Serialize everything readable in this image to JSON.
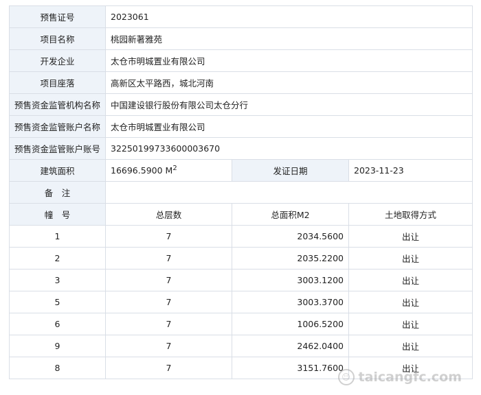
{
  "fields": {
    "permit_no": {
      "label": "预售证号",
      "value": "2023061"
    },
    "project_name": {
      "label": "项目名称",
      "value": "桃园新著雅苑"
    },
    "developer": {
      "label": "开发企业",
      "value": "太仓市明城置业有限公司"
    },
    "location": {
      "label": "项目座落",
      "value": "高新区太平路西，城北河南"
    },
    "supervisor_org": {
      "label": "预售资金监管机构名称",
      "value": "中国建设银行股份有限公司太仓分行"
    },
    "account_name": {
      "label": "预售资金监管账户名称",
      "value": "太仓市明城置业有限公司"
    },
    "account_no": {
      "label": "预售资金监管账户账号",
      "value": "32250199733600003670"
    }
  },
  "area": {
    "label": "建筑面积",
    "value": "16696.5900",
    "unit": "M",
    "unit_sup": "2"
  },
  "issue_date": {
    "label": "发证日期",
    "value": "2023-11-23"
  },
  "remark": {
    "label": "备　注",
    "value": ""
  },
  "buildings_header": [
    "幢　号",
    "总层数",
    "总面积M2",
    "土地取得方式"
  ],
  "buildings": [
    [
      "1",
      "7",
      "2034.5600",
      "出让"
    ],
    [
      "2",
      "7",
      "2035.2200",
      "出让"
    ],
    [
      "3",
      "7",
      "3003.1200",
      "出让"
    ],
    [
      "5",
      "7",
      "3003.3700",
      "出让"
    ],
    [
      "6",
      "7",
      "1006.5200",
      "出让"
    ],
    [
      "9",
      "7",
      "2462.0400",
      "出让"
    ],
    [
      "8",
      "7",
      "3151.7600",
      "出让"
    ]
  ],
  "watermark": {
    "text": "taicangfc.com"
  }
}
